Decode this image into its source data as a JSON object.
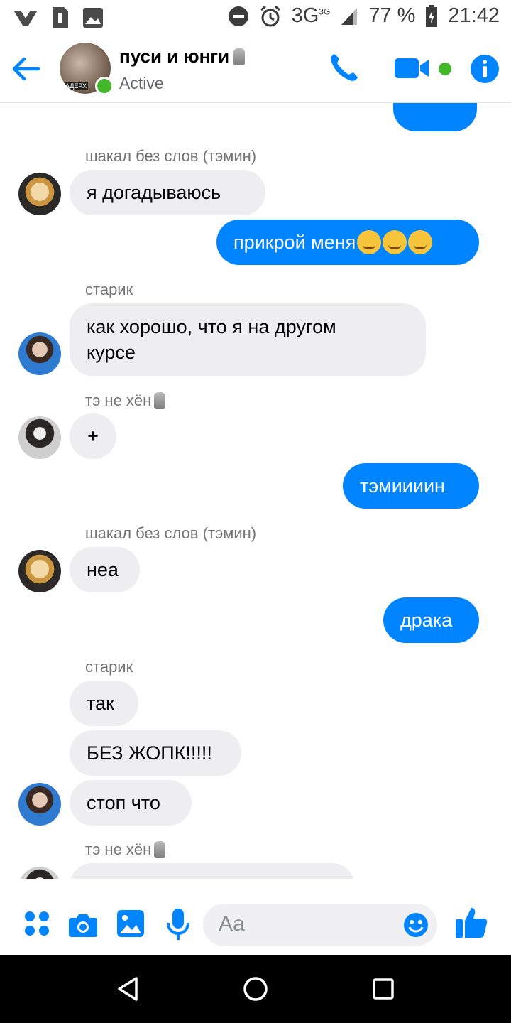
{
  "status_bar": {
    "network": "3G",
    "network_sup": "3G",
    "battery": "77 %",
    "time": "21:42",
    "icons": [
      "vk-icon",
      "sim-icon",
      "image-icon",
      "dnd-icon",
      "alarm-icon",
      "signal-icon",
      "battery-icon"
    ]
  },
  "header": {
    "title": "пуси и юнги",
    "subtitle": "Active",
    "icons": [
      "back-arrow-icon",
      "phone-icon",
      "video-icon",
      "info-icon"
    ]
  },
  "messages": [
    {
      "sender": "шакал без слов (тэмин)",
      "text": "я догадываюсь",
      "dir": "in"
    },
    {
      "text": "прикрой меня",
      "dir": "out",
      "emoji_count": 3
    },
    {
      "sender": "старик",
      "text_line1": "как хорошо, что я на другом",
      "text_line2": "курсе",
      "dir": "in"
    },
    {
      "sender": "тэ не хён",
      "text": "+",
      "dir": "in"
    },
    {
      "text": "тэмиииин",
      "dir": "out"
    },
    {
      "sender": "шакал без слов (тэмин)",
      "text": "неа",
      "dir": "in"
    },
    {
      "text": "драка",
      "dir": "out"
    },
    {
      "sender": "старик",
      "text": "так",
      "dir": "in"
    },
    {
      "text": "БЕЗ ЖОПК!!!!!",
      "dir": "in"
    },
    {
      "text": "стоп что",
      "dir": "in"
    },
    {
      "sender": "тэ не хён",
      "dir": "in"
    }
  ],
  "composer": {
    "placeholder": "Aa",
    "icons": [
      "more-icon",
      "camera-icon",
      "gallery-icon",
      "mic-icon",
      "emoji-icon",
      "like-icon"
    ]
  },
  "navbar": {
    "icons": [
      "back-nav-icon",
      "home-nav-icon",
      "recents-nav-icon"
    ]
  },
  "colors": {
    "accent": "#0084ff",
    "bubble_in": "#eeedf0",
    "online": "#42b72a"
  }
}
